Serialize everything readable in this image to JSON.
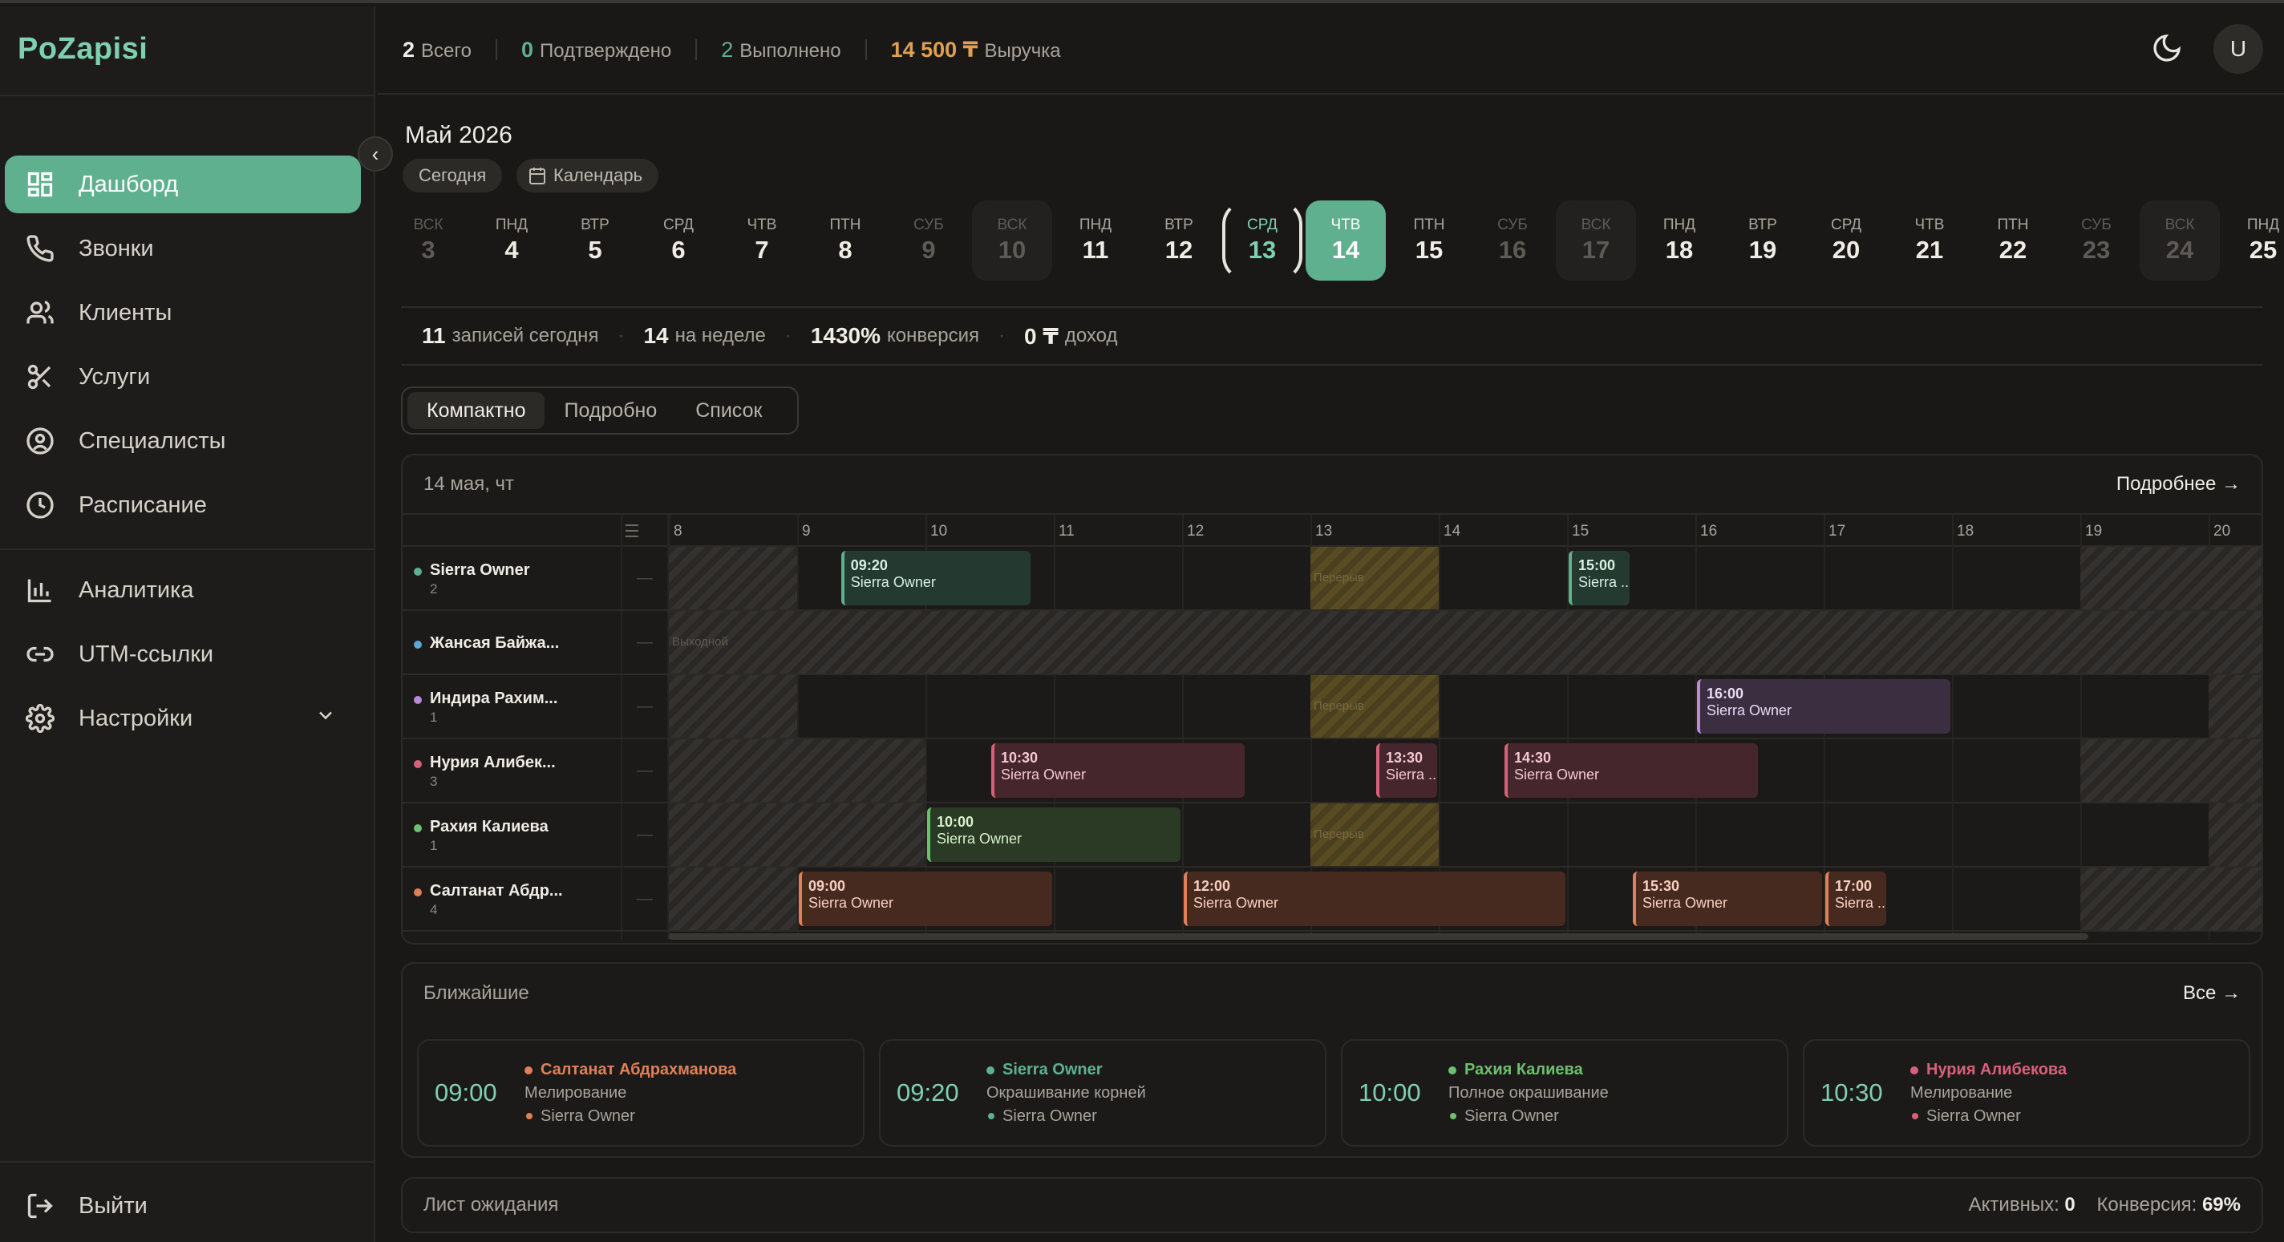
{
  "app": {
    "logo": "PoZapisi"
  },
  "sidebar": {
    "items": [
      {
        "label": "Дашборд",
        "icon": "dashboard-icon",
        "active": true
      },
      {
        "label": "Звонки",
        "icon": "phone-icon"
      },
      {
        "label": "Клиенты",
        "icon": "users-icon"
      },
      {
        "label": "Услуги",
        "icon": "scissors-icon"
      },
      {
        "label": "Специалисты",
        "icon": "user-circle-icon"
      },
      {
        "label": "Расписание",
        "icon": "clock-icon"
      },
      {
        "label": "Аналитика",
        "icon": "bar-chart-icon"
      },
      {
        "label": "UTM-ссылки",
        "icon": "link-icon"
      },
      {
        "label": "Настройки",
        "icon": "gear-icon"
      }
    ],
    "logout": "Выйти"
  },
  "topbar": {
    "total_value": "2",
    "total_label": "Всего",
    "confirmed_value": "0",
    "confirmed_label": "Подтверждено",
    "done_value": "2",
    "done_label": "Выполнено",
    "revenue_value": "14 500 ₸",
    "revenue_label": "Выручка",
    "avatar": "U"
  },
  "calendar": {
    "month": "Май 2026",
    "today_btn": "Сегодня",
    "calendar_btn": "Календарь",
    "days": [
      {
        "dw": "вск",
        "dn": "3"
      },
      {
        "dw": "пнд",
        "dn": "4"
      },
      {
        "dw": "втр",
        "dn": "5"
      },
      {
        "dw": "срд",
        "dn": "6"
      },
      {
        "dw": "чтв",
        "dn": "7"
      },
      {
        "dw": "птн",
        "dn": "8"
      },
      {
        "dw": "суб",
        "dn": "9"
      },
      {
        "dw": "вск",
        "dn": "10"
      },
      {
        "dw": "пнд",
        "dn": "11"
      },
      {
        "dw": "втр",
        "dn": "12"
      },
      {
        "dw": "срд",
        "dn": "13"
      },
      {
        "dw": "чтв",
        "dn": "14"
      },
      {
        "dw": "птн",
        "dn": "15"
      },
      {
        "dw": "суб",
        "dn": "16"
      },
      {
        "dw": "вск",
        "dn": "17"
      },
      {
        "dw": "пнд",
        "dn": "18"
      },
      {
        "dw": "втр",
        "dn": "19"
      },
      {
        "dw": "срд",
        "dn": "20"
      },
      {
        "dw": "чтв",
        "dn": "21"
      },
      {
        "dw": "птн",
        "dn": "22"
      },
      {
        "dw": "суб",
        "dn": "23"
      },
      {
        "dw": "вск",
        "dn": "24"
      },
      {
        "dw": "пнд",
        "dn": "25"
      }
    ]
  },
  "kpis": {
    "today_value": "11",
    "today_label": "записей сегодня",
    "week_value": "14",
    "week_label": "на неделе",
    "conv_value": "1430%",
    "conv_label": "конверсия",
    "income_value": "0 ₸",
    "income_label": "доход"
  },
  "view_tabs": [
    "Компактно",
    "Подробно",
    "Список"
  ],
  "schedule": {
    "date": "14 мая, чт",
    "more": "Подробнее",
    "hours": [
      "8",
      "9",
      "10",
      "11",
      "12",
      "13",
      "14",
      "15",
      "16",
      "17",
      "18",
      "19",
      "20"
    ],
    "break_label": "Перерыв",
    "dayoff_label": "Выходной",
    "rows": [
      {
        "name": "Sierra Owner",
        "count": "2",
        "color": "#5fb08f"
      },
      {
        "name": "Жансая Байжа...",
        "count": "",
        "color": "#5aa8d8"
      },
      {
        "name": "Индира Рахим...",
        "count": "1",
        "color": "#b88ad8"
      },
      {
        "name": "Нурия Алибек...",
        "count": "3",
        "color": "#d8607a"
      },
      {
        "name": "Рахия Калиева",
        "count": "1",
        "color": "#6cc070"
      },
      {
        "name": "Салтанат Абдр...",
        "count": "4",
        "color": "#e0805a"
      }
    ],
    "events": [
      {
        "time": "09:20",
        "who": "Sierra Owner"
      },
      {
        "time": "15:00",
        "who": "Sierra ..."
      },
      {
        "time": "16:00",
        "who": "Sierra Owner"
      },
      {
        "time": "10:30",
        "who": "Sierra Owner"
      },
      {
        "time": "13:30",
        "who": "Sierra ..."
      },
      {
        "time": "14:30",
        "who": "Sierra Owner"
      },
      {
        "time": "10:00",
        "who": "Sierra Owner"
      },
      {
        "time": "09:00",
        "who": "Sierra Owner"
      },
      {
        "time": "12:00",
        "who": "Sierra Owner"
      },
      {
        "time": "15:30",
        "who": "Sierra Owner"
      },
      {
        "time": "17:00",
        "who": "Sierra ..."
      }
    ]
  },
  "upcoming": {
    "title": "Ближайшие",
    "all": "Все",
    "cards": [
      {
        "time": "09:00",
        "client": "Салтанат Абдрахманова",
        "service": "Мелирование",
        "master": "Sierra Owner",
        "color": "#e0805a"
      },
      {
        "time": "09:20",
        "client": "Sierra Owner",
        "service": "Окрашивание корней",
        "master": "Sierra Owner",
        "color": "#5fb08f"
      },
      {
        "time": "10:00",
        "client": "Рахия Калиева",
        "service": "Полное окрашивание",
        "master": "Sierra Owner",
        "color": "#6cc070"
      },
      {
        "time": "10:30",
        "client": "Нурия Алибекова",
        "service": "Мелирование",
        "master": "Sierra Owner",
        "color": "#d8607a"
      }
    ]
  },
  "waitlist": {
    "title": "Лист ожидания",
    "active_label": "Активных:",
    "active_value": "0",
    "conv_label": "Конверсия:",
    "conv_value": "69%"
  }
}
